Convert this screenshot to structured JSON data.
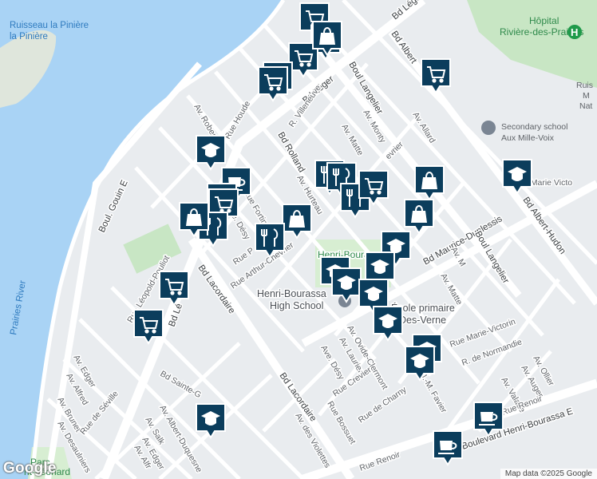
{
  "colors": {
    "water": "#a9d3f5",
    "land": "#e9ecef",
    "park": "#c8e6c4",
    "road": "#ffffff",
    "marker": "#0b3d5c",
    "marker_border": "#ffffff"
  },
  "street_labels": [
    "Bd Léger",
    "Boul. Gouin E",
    "Bd Albert",
    "Boul Langelier",
    "Av. Allard",
    "R. Villeneuve",
    "Av. Monty",
    "Av. Matte",
    "Bd Rolland",
    "Av. Robert",
    "Rue Houde",
    "Av. Hurteau",
    "Rue Fortin",
    "Av. Désy",
    "Rue P",
    "Rue Arthur-Chevrier",
    "Rue Léopold-Pouliot",
    "Bd Lacordaire",
    "Bd Lé",
    "Bd Maurice-Duplessis",
    "Bd Albert-Hudon",
    "Av. M",
    "Av. Matte",
    "Rue Marie-Victorin",
    "R. de Normandie",
    "Av. Ovide-Clermont",
    "Av. Laurier",
    "Av. Désy",
    "Rue Crevier",
    "Rue de Charny",
    "Av. J.-M. Favier",
    "Av. Ollier",
    "Av. Auger",
    "Av. Valade",
    "Rue Renoir",
    "Boulevard Henri-Bourassa E",
    "Rue Bossuet",
    "Av. des Violettes",
    "Bd Sainte-G",
    "Av. Edger",
    "Av. Alfred",
    "Av. Brunet",
    "Rue de Séville",
    "Av. Desaulniers",
    "Av. Salk",
    "Av. Albert-Duquesne",
    "Av. Edger",
    "Av. Alfr",
    "Rue P",
    "Rue Renoir",
    "Av. Allard",
    "Monty",
    "Marie Victo",
    "Rue Gr",
    "Ru"
  ],
  "places": {
    "hospital": "Hôpital\nRivière-des-Prairies",
    "school_secondary": "Secondary school\nAux Mille-Voix",
    "ruisseau": "Ruisseau\nla Pinière",
    "ruisseau_right": "Ruis\nM\nNat",
    "henri_bourassa_hs": "Henri-Bourassa\nHigh School",
    "henri_bourassa_park": "Henri-Bourassa Park",
    "ecole_primaire": "École primaire\nDes-Verne",
    "prairies_river": "Prairies River",
    "parc": "Parc\nnt-Léonard"
  },
  "markers": [
    {
      "icon": "shopping-cart-icon"
    },
    {
      "icon": "shopping-bag-icon"
    },
    {
      "icon": "shopping-cart-icon"
    },
    {
      "icon": "shopping-bag-icon"
    },
    {
      "icon": "shopping-cart-icon"
    },
    {
      "icon": "shopping-cart-icon"
    },
    {
      "icon": "school-icon"
    },
    {
      "icon": "cafe-icon"
    },
    {
      "icon": "restaurant-icon"
    },
    {
      "icon": "shopping-cart-icon"
    },
    {
      "icon": "restaurant-icon"
    },
    {
      "icon": "shopping-bag-icon"
    },
    {
      "icon": "restaurant-icon"
    },
    {
      "icon": "shopping-bag-icon"
    },
    {
      "icon": "restaurant-icon"
    },
    {
      "icon": "restaurant-icon"
    },
    {
      "icon": "shopping-cart-icon"
    },
    {
      "icon": "shopping-bag-icon"
    },
    {
      "icon": "restaurant-icon"
    },
    {
      "icon": "school-icon"
    },
    {
      "icon": "shopping-bag-icon"
    },
    {
      "icon": "school-icon"
    },
    {
      "icon": "school-icon"
    },
    {
      "icon": "school-icon"
    },
    {
      "icon": "school-icon"
    },
    {
      "icon": "shopping-cart-icon"
    },
    {
      "icon": "shopping-cart-icon"
    },
    {
      "icon": "shopping-cart-icon"
    },
    {
      "icon": "school-icon"
    },
    {
      "icon": "school-icon"
    },
    {
      "icon": "school-icon"
    },
    {
      "icon": "school-icon"
    },
    {
      "icon": "cafe-icon"
    },
    {
      "icon": "cafe-icon"
    },
    {
      "icon": "school-icon"
    }
  ],
  "attribution": "Map data ©2025 Google",
  "logo": "Google"
}
